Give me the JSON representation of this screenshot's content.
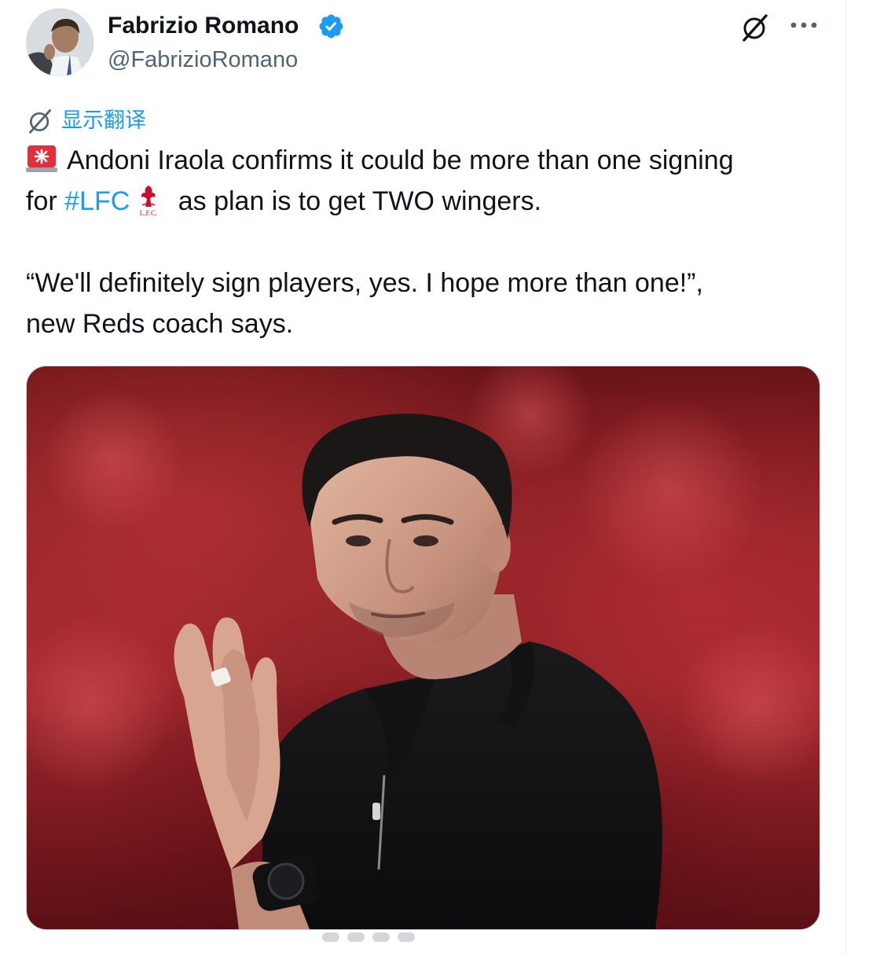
{
  "tweet": {
    "author": {
      "name": "Fabrizio Romano",
      "handle": "@FabrizioRomano",
      "verified": true
    },
    "translate_label": "显示翻译",
    "text_line1": "Andoni Iraola confirms it could be more than one signing",
    "text_line2_pre": "for ",
    "hashtag": "#LFC",
    "text_line2_post": " as plan is to get TWO wingers.",
    "quote_line1": "“We'll definitely sign players, yes. I hope more than one!”,",
    "quote_line2": "new Reds coach says.",
    "crest_text": "L.F.C.",
    "emoji_icons": [
      "rotating-light-icon",
      "liverpool-crest-icon"
    ]
  },
  "header_icons": [
    "grok-icon",
    "more-icon"
  ],
  "colors": {
    "accent": "#1d9bf0",
    "text": "#0f1419",
    "secondary": "#536471",
    "liverpool_red": "#c8102e"
  }
}
